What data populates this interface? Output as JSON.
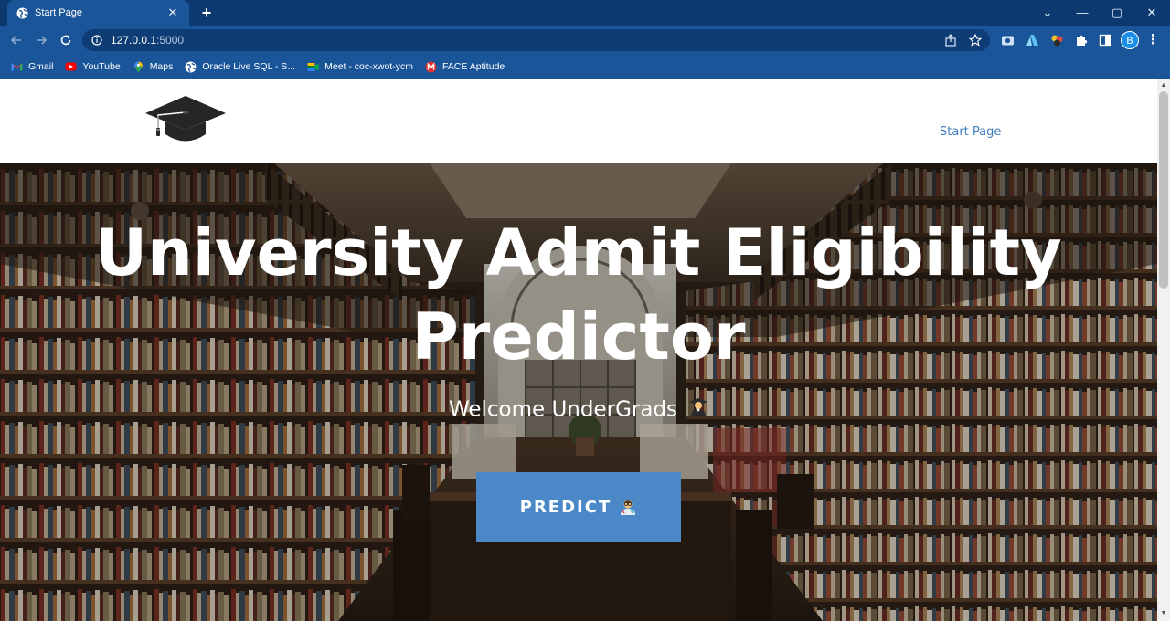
{
  "browser": {
    "tab": {
      "title": "Start Page",
      "close_glyph": "✕"
    },
    "new_tab_glyph": "+",
    "window_controls": {
      "dropdown": "⌄",
      "minimize": "—",
      "restore": "▢",
      "close": "✕"
    },
    "address": {
      "host": "127.0.0.1",
      "port": ":5000"
    },
    "avatar_letter": "B",
    "menu_glyph": "⋮",
    "bookmarks": [
      {
        "label": "Gmail",
        "icon": "gmail-icon"
      },
      {
        "label": "YouTube",
        "icon": "youtube-icon"
      },
      {
        "label": "Maps",
        "icon": "maps-icon"
      },
      {
        "label": "Oracle Live SQL - S...",
        "icon": "globe-icon"
      },
      {
        "label": "Meet - coc-xwot-ycm",
        "icon": "meet-icon"
      },
      {
        "label": "FACE Aptitude",
        "icon": "face-icon"
      }
    ]
  },
  "site": {
    "logo_icon": "graduation-cap-icon",
    "nav_link": "Start Page",
    "hero": {
      "title_line1": "University Admit Eligibility",
      "title_line2": "Predictor",
      "subtitle": "Welcome UnderGrads",
      "subtitle_icon": "student-icon",
      "button_label": "PREDICT",
      "button_icon": "scientist-icon"
    }
  },
  "colors": {
    "tabstrip": "#0c3a70",
    "toolbar": "#1a5499",
    "nav_link": "#3f7dc0",
    "button": "#4a88c8"
  }
}
